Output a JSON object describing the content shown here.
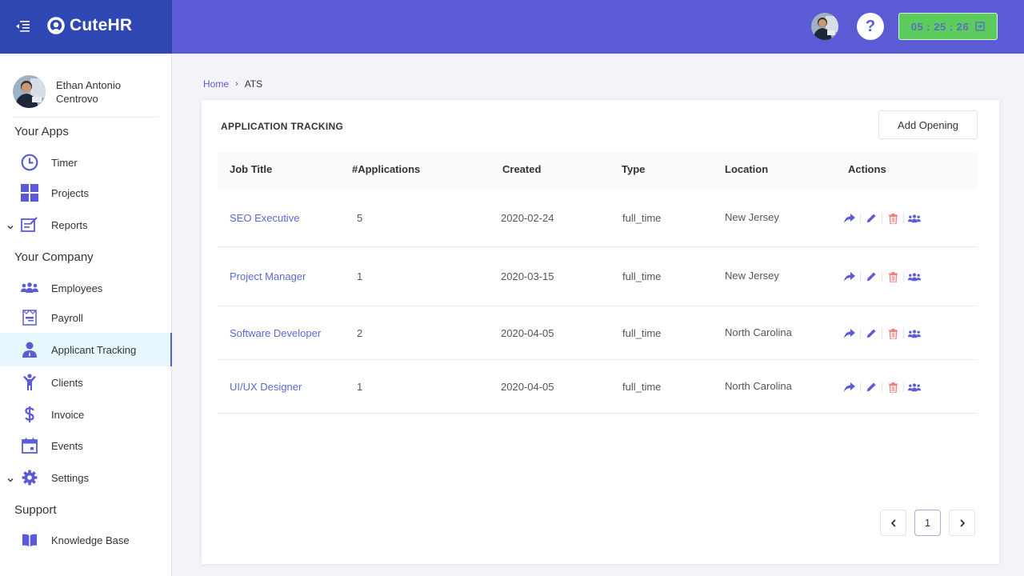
{
  "app": {
    "brand_name": "CuteHR",
    "timer": "05 : 25 : 26",
    "help_label": "?",
    "colors": {
      "topbar": "#5b5bd6",
      "brand_bg": "#2e47b3",
      "accent": "#5b5bd6",
      "timer_bg": "#5ccc5c",
      "delete": "#f07a7a",
      "active_nav_bg": "#e6f7fd"
    }
  },
  "user": {
    "name": "Ethan Antonio Centrovo"
  },
  "sidebar": {
    "sections": [
      {
        "label": "Your Apps",
        "items": [
          {
            "label": "Timer",
            "icon": "clock-icon"
          },
          {
            "label": "Projects",
            "icon": "grid-icon"
          },
          {
            "label": "Reports",
            "icon": "report-icon",
            "expandable": true
          }
        ]
      },
      {
        "label": "Your Company",
        "items": [
          {
            "label": "Employees",
            "icon": "users-icon"
          },
          {
            "label": "Payroll",
            "icon": "payroll-icon"
          },
          {
            "label": "Applicant Tracking",
            "icon": "user-tie-icon",
            "active": true
          },
          {
            "label": "Clients",
            "icon": "person-raised-icon"
          },
          {
            "label": "Invoice",
            "icon": "dollar-icon"
          },
          {
            "label": "Events",
            "icon": "calendar-icon"
          },
          {
            "label": "Settings",
            "icon": "gear-icon",
            "expandable": true
          }
        ]
      },
      {
        "label": "Support",
        "items": [
          {
            "label": "Knowledge Base",
            "icon": "book-icon"
          }
        ]
      }
    ]
  },
  "breadcrumb": {
    "home": "Home",
    "separator": "›",
    "current": "ATS"
  },
  "page": {
    "title": "APPLICATION TRACKING",
    "add_button": "Add Opening"
  },
  "table": {
    "columns": [
      "Job Title",
      "#Applications",
      "Created",
      "Type",
      "Location",
      "Actions"
    ],
    "rows": [
      {
        "job_title": "SEO Executive",
        "applications": "5",
        "created": "2020-02-24",
        "type": "full_time",
        "location": "New Jersey"
      },
      {
        "job_title": "Project Manager",
        "applications": "1",
        "created": "2020-03-15",
        "type": "full_time",
        "location": "New Jersey"
      },
      {
        "job_title": "Software Developer",
        "applications": "2",
        "created": "2020-04-05",
        "type": "full_time",
        "location": "North Carolina"
      },
      {
        "job_title": "UI/UX Designer",
        "applications": "1",
        "created": "2020-04-05",
        "type": "full_time",
        "location": "North Carolina"
      }
    ],
    "row_actions": [
      "share-icon",
      "edit-icon",
      "delete-icon",
      "applicants-icon"
    ]
  },
  "pagination": {
    "prev": "‹",
    "current_page": "1",
    "next": "›"
  }
}
